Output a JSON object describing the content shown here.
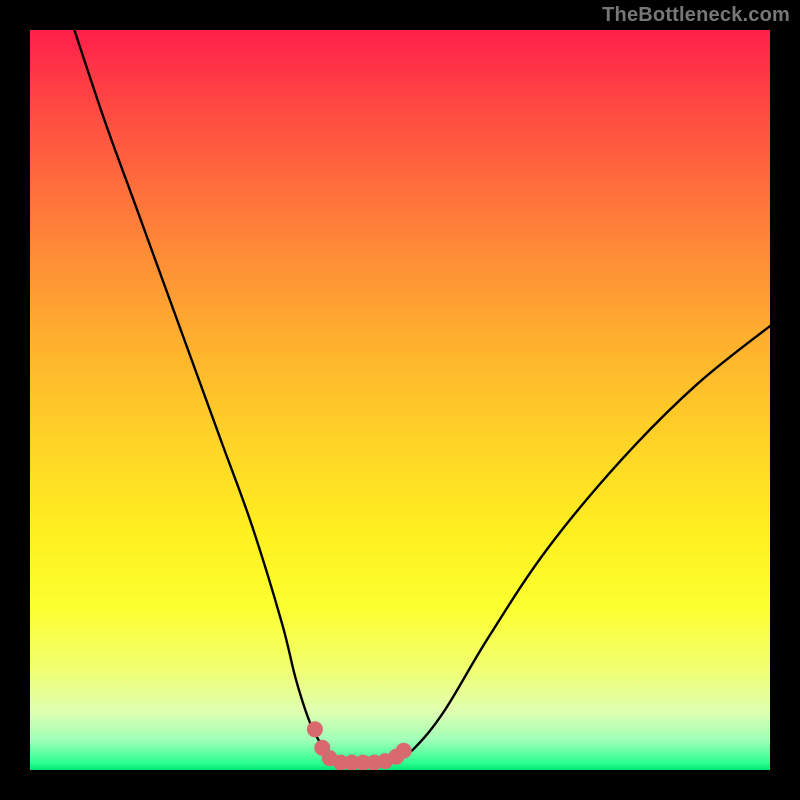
{
  "watermark": "TheBottleneck.com",
  "chart_data": {
    "type": "line",
    "title": "",
    "xlabel": "",
    "ylabel": "",
    "xlim": [
      0,
      100
    ],
    "ylim": [
      0,
      100
    ],
    "grid": false,
    "legend": false,
    "series": [
      {
        "name": "bottleneck-curve",
        "x": [
          6,
          10,
          14,
          18,
          22,
          26,
          30,
          34,
          36,
          38,
          40,
          41,
          42,
          43,
          44,
          46,
          48,
          50,
          52,
          56,
          62,
          70,
          80,
          90,
          100
        ],
        "y": [
          100,
          88,
          77,
          66,
          55,
          44,
          33,
          20,
          12,
          6,
          2.5,
          1.5,
          1,
          1,
          1,
          1,
          1.2,
          1.8,
          3,
          8,
          18,
          30,
          42,
          52,
          60
        ]
      }
    ],
    "markers": {
      "name": "valley-markers",
      "color": "#d86a6f",
      "points": [
        {
          "x": 38.5,
          "y": 5.5
        },
        {
          "x": 39.5,
          "y": 3.0
        },
        {
          "x": 40.5,
          "y": 1.6
        },
        {
          "x": 42.0,
          "y": 1.0
        },
        {
          "x": 43.5,
          "y": 1.0
        },
        {
          "x": 45.0,
          "y": 1.0
        },
        {
          "x": 46.5,
          "y": 1.0
        },
        {
          "x": 48.0,
          "y": 1.2
        },
        {
          "x": 49.5,
          "y": 1.8
        },
        {
          "x": 50.5,
          "y": 2.6
        }
      ]
    },
    "background_gradient": {
      "top": "#ff1f4b",
      "mid": "#fff020",
      "bottom": "#00e878"
    }
  }
}
